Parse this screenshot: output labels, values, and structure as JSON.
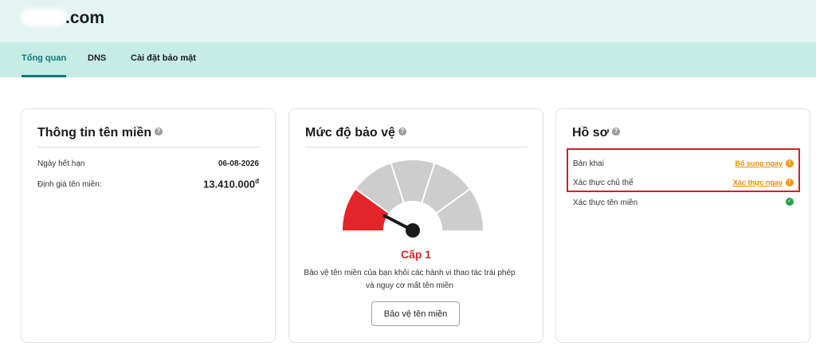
{
  "header": {
    "domain_suffix": ".com"
  },
  "nav": {
    "tabs": [
      {
        "label": "Tổng quan"
      },
      {
        "label": "DNS"
      },
      {
        "label": "Cài đặt bảo mật"
      }
    ]
  },
  "domain_info": {
    "title": "Thông tin tên miền",
    "expiry_label": "Ngày hết hạn",
    "expiry_value": "06-08-2026",
    "valuation_label": "Định giá tên miền:",
    "valuation_value": "13.410.000",
    "currency": "đ"
  },
  "protection": {
    "title": "Mức độ bảo vệ",
    "level_label": "Cấp 1",
    "level": 1,
    "max_level": 5,
    "description": "Bảo vệ tên miền của bạn khỏi các hành vi thao tác trái phép và nguy cơ mất tên miền",
    "button_label": "Bảo vệ tên miền",
    "gauge_active_color": "#e3252a",
    "gauge_inactive_color": "#cdcdcd"
  },
  "profile": {
    "title": "Hồ sơ",
    "items": [
      {
        "label": "Bản khai",
        "action": "Bổ sung ngay",
        "status": "warning"
      },
      {
        "label": "Xác thực chủ thể",
        "action": "Xác thực ngay",
        "status": "warning"
      },
      {
        "label": "Xác thực tên miền",
        "status": "ok"
      }
    ]
  },
  "colors": {
    "accent": "#0f7a78",
    "link": "#f08c00",
    "warning": "#f39a0b",
    "ok": "#24a148",
    "highlight_border": "#d61e25"
  },
  "icons": {
    "help": "help-icon",
    "warning": "warning-icon",
    "ok": "check-icon"
  }
}
